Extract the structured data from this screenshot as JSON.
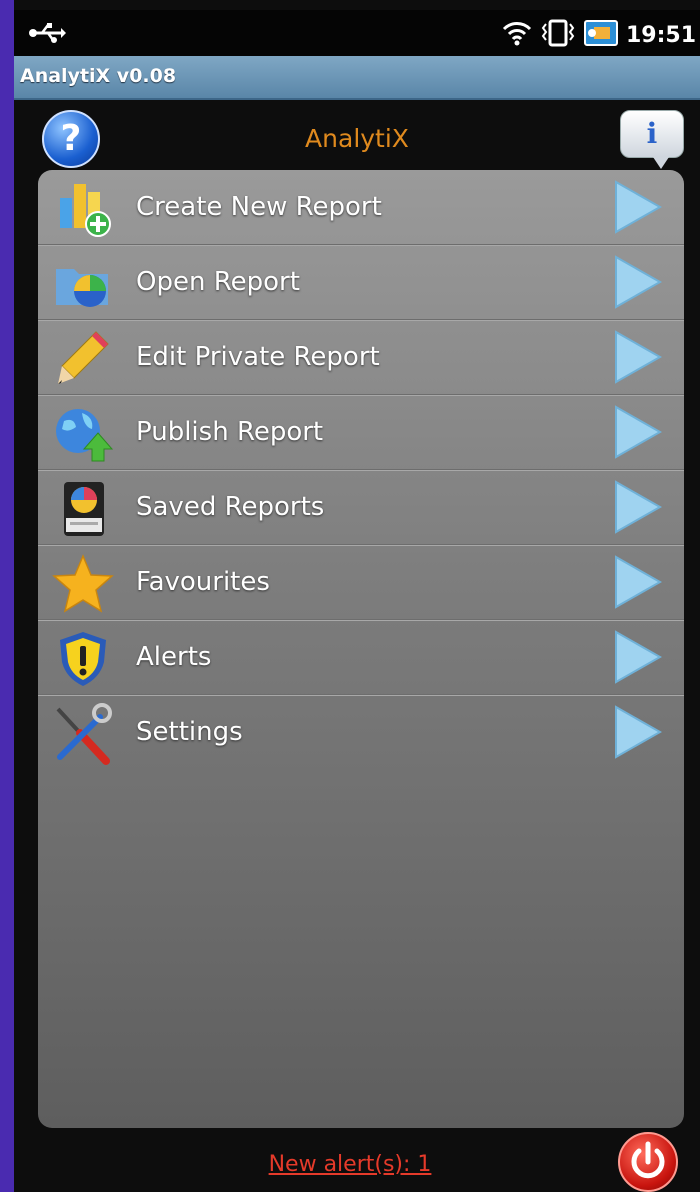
{
  "status_bar": {
    "time": "19:51",
    "icons": [
      "usb-icon",
      "wifi-icon",
      "vibrate-icon",
      "photo-notification-icon"
    ]
  },
  "title_bar": {
    "title": "AnalytiX v0.08"
  },
  "header": {
    "heading": "AnalytiX",
    "help_glyph": "?",
    "info_glyph": "i",
    "heading_color": "#e08a1e"
  },
  "menu": {
    "items": [
      {
        "label": "Create New Report",
        "icon": "create-report-icon"
      },
      {
        "label": "Open Report",
        "icon": "open-report-icon"
      },
      {
        "label": "Edit Private Report",
        "icon": "pencil-icon"
      },
      {
        "label": "Publish Report",
        "icon": "globe-upload-icon"
      },
      {
        "label": "Saved Reports",
        "icon": "saved-reports-icon"
      },
      {
        "label": "Favourites",
        "icon": "star-icon"
      },
      {
        "label": "Alerts",
        "icon": "shield-alert-icon"
      },
      {
        "label": "Settings",
        "icon": "tools-icon"
      }
    ]
  },
  "footer": {
    "alert_link": "New alert(s): 1",
    "alert_color": "#e53a2a"
  }
}
